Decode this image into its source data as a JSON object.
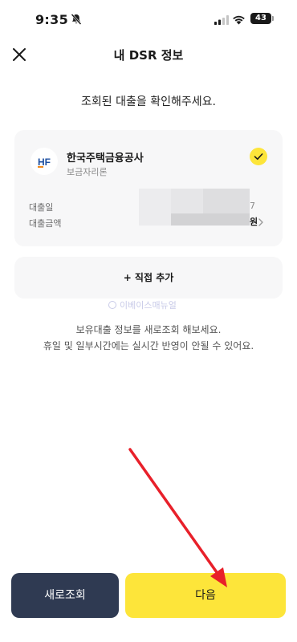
{
  "status_bar": {
    "time": "9:35",
    "battery": "43",
    "icons": [
      "mute-bell-icon",
      "signal-icon",
      "wifi-icon",
      "battery-icon"
    ]
  },
  "header": {
    "title": "내 DSR 정보",
    "close_icon": "close-icon"
  },
  "instruction": "조회된 대출을 확인해주세요.",
  "loan_card": {
    "lender_name": "한국주택금융공사",
    "logo_text": "HF",
    "product": "보금자리론",
    "selected": true,
    "rows": [
      {
        "label": "대출일",
        "value_visible": "7"
      },
      {
        "label": "대출금액",
        "value_visible": "원"
      }
    ]
  },
  "add_direct_label": "+ 직접 추가",
  "watermark": "이베이스매뉴얼",
  "notes": [
    "보유대출 정보를 새로조회 해보세요.",
    "휴일 및 일부시간에는 실시간 반영이 안될 수 있어요."
  ],
  "buttons": {
    "refresh": "새로조회",
    "next": "다음"
  },
  "colors": {
    "accent_yellow": "#fde53a",
    "navy": "#2f3a52",
    "card_bg": "#f7f7f8",
    "annotation_red": "#e8202a"
  }
}
